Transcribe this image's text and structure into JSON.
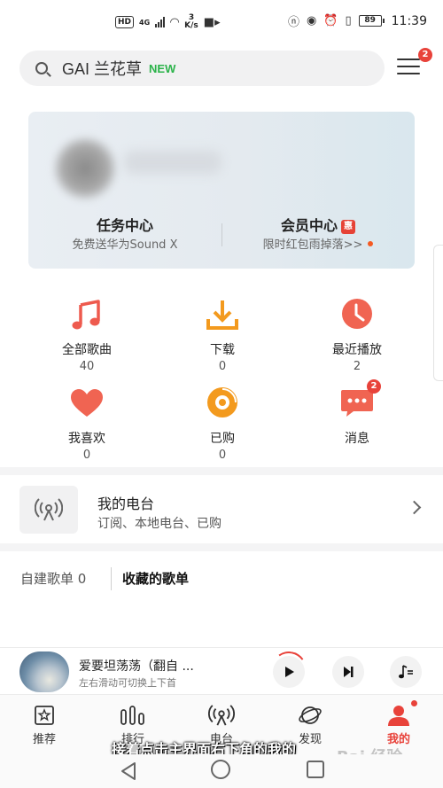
{
  "status_bar": {
    "hd": "HD",
    "network": "4G",
    "speed_value": "3",
    "speed_unit": "K/s",
    "battery": "89",
    "time": "11:39"
  },
  "search": {
    "query": "GAI 兰花草",
    "tag": "NEW",
    "menu_badge": "2"
  },
  "profile_card": {
    "task_center_title": "任务中心",
    "task_center_subtitle": "免费送华为Sound X",
    "vip_center_title": "会员中心",
    "vip_tag": "惠",
    "vip_center_subtitle": "限时红包雨掉落>>"
  },
  "grid": [
    {
      "label": "全部歌曲",
      "count": "40",
      "icon": "music-note-icon"
    },
    {
      "label": "下载",
      "count": "0",
      "icon": "download-icon"
    },
    {
      "label": "最近播放",
      "count": "2",
      "icon": "clock-icon"
    },
    {
      "label": "我喜欢",
      "count": "0",
      "icon": "heart-icon"
    },
    {
      "label": "已购",
      "count": "0",
      "icon": "purchased-disc-icon"
    },
    {
      "label": "消息",
      "count": "",
      "badge": "2",
      "icon": "message-bubble-icon"
    }
  ],
  "radio": {
    "title": "我的电台",
    "subtitle": "订阅、本地电台、已购"
  },
  "playlists": {
    "created_label": "自建歌单 0",
    "collected_label": "收藏的歌单"
  },
  "player": {
    "song_title": "爱要坦荡荡（翻自 ...",
    "hint": "左右滑动可切换上下首"
  },
  "bottom_nav": [
    {
      "label": "推荐",
      "icon": "star-box-icon"
    },
    {
      "label": "排行",
      "icon": "chart-bars-icon"
    },
    {
      "label": "电台",
      "icon": "radio-antenna-icon"
    },
    {
      "label": "发现",
      "icon": "planet-icon"
    },
    {
      "label": "我的",
      "icon": "person-icon",
      "active": true
    }
  ],
  "overlay": {
    "subtitle": "接着点击主界面右下角的我的",
    "watermark": "Bai 经验"
  },
  "colors": {
    "accent_red": "#e8423a",
    "orange": "#f39a1e",
    "new_green": "#2bb34a"
  }
}
